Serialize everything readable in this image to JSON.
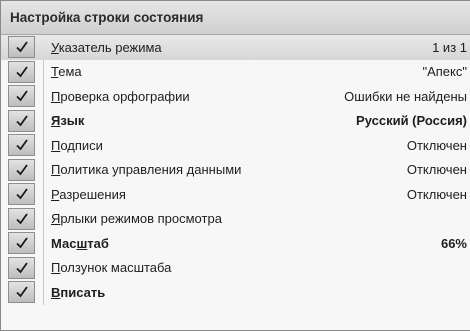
{
  "menu": {
    "title": "Настройка строки состояния",
    "items": [
      {
        "label_u": "У",
        "label_rest": "казатель режима",
        "value": "1 из 1",
        "checked": true
      },
      {
        "label_u": "Т",
        "label_rest": "ема",
        "value": "\"Апекс\"",
        "checked": true
      },
      {
        "label_u": "П",
        "label_rest": "роверка орфографии",
        "value": "Ошибки не найдены",
        "checked": true
      },
      {
        "label_u": "Я",
        "label_rest": "зык",
        "value": "Русский (Россия)",
        "checked": true
      },
      {
        "label_u": "П",
        "label_rest": "одписи",
        "value": "Отключен",
        "checked": true
      },
      {
        "label_u": "П",
        "label_rest": "олитика управления данными",
        "value": "Отключен",
        "checked": true
      },
      {
        "label_u": "Р",
        "label_rest": "азрешения",
        "value": "Отключен",
        "checked": true
      },
      {
        "label_u": "Я",
        "label_rest": "рлыки режимов просмотра",
        "value": "",
        "checked": true
      },
      {
        "label_pre": "Мас",
        "label_u": "ш",
        "label_rest": "таб",
        "value": "66%",
        "checked": true
      },
      {
        "label_u": "П",
        "label_rest": "олзунок масштаба",
        "value": "",
        "checked": true
      },
      {
        "label_u": "В",
        "label_rest": "писать",
        "value": "",
        "checked": true
      }
    ]
  }
}
